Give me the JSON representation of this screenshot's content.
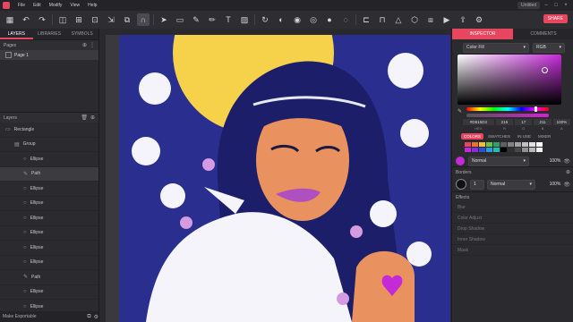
{
  "menu": [
    "File",
    "Edit",
    "Modify",
    "View",
    "Help"
  ],
  "title_right": "Untitled",
  "share_label": "SHARE",
  "left_tabs": [
    "LAYERS",
    "LIBRARIES",
    "SYMBOLS"
  ],
  "pages": {
    "header": "Pages",
    "items": [
      "Page 1"
    ]
  },
  "layers": {
    "header": "Layers",
    "items": [
      {
        "label": "Rectangle",
        "indent": 0,
        "icon": "rect"
      },
      {
        "label": "Group",
        "indent": 1,
        "icon": "group"
      },
      {
        "label": "Ellipse",
        "indent": 2,
        "icon": "ellipse"
      },
      {
        "label": "Path",
        "indent": 2,
        "icon": "path",
        "selected": true
      },
      {
        "label": "Ellipse",
        "indent": 2,
        "icon": "ellipse"
      },
      {
        "label": "Ellipse",
        "indent": 2,
        "icon": "ellipse"
      },
      {
        "label": "Ellipse",
        "indent": 2,
        "icon": "ellipse"
      },
      {
        "label": "Ellipse",
        "indent": 2,
        "icon": "ellipse"
      },
      {
        "label": "Ellipse",
        "indent": 2,
        "icon": "ellipse"
      },
      {
        "label": "Ellipse",
        "indent": 2,
        "icon": "ellipse"
      },
      {
        "label": "Path",
        "indent": 2,
        "icon": "path"
      },
      {
        "label": "Ellipse",
        "indent": 2,
        "icon": "ellipse"
      },
      {
        "label": "Ellipse",
        "indent": 2,
        "icon": "ellipse"
      }
    ]
  },
  "make_exportable": "Make Exportable",
  "right_tabs": [
    "INSPECTOR",
    "COMMENTS"
  ],
  "fill": {
    "mode": "Color Fill",
    "model": "RGB"
  },
  "color": {
    "hex": "#D815D3",
    "r": "216",
    "g": "17",
    "b": "211",
    "a": "100%",
    "labels": [
      "HEX",
      "R",
      "G",
      "B",
      "A"
    ]
  },
  "swatch_tabs": [
    "COLORS",
    "SWATCHES",
    "IN USE",
    "MIXER"
  ],
  "swatch_colors": [
    "#e8455e",
    "#f07030",
    "#f0c030",
    "#70c040",
    "#30a070",
    "#606060",
    "#808080",
    "#a0a0a0",
    "#c0c0c0",
    "#e0e0e0",
    "#ffffff",
    "#c42ad8",
    "#8a2be2",
    "#3050d0",
    "#20a0e0",
    "#20c0b0",
    "#000000",
    "#303030",
    "#484848",
    "#909090",
    "#b8b8b8",
    "#f0f0f0"
  ],
  "fill_blend": "Normal",
  "fill_opacity": "100%",
  "borders_header": "Borders",
  "border": {
    "width": "1",
    "blend": "Normal",
    "opacity": "100%"
  },
  "effects_header": "Effects",
  "effects": [
    "Blur",
    "Color Adjust",
    "Drop Shadow",
    "Inner Shadow",
    "Mask"
  ]
}
